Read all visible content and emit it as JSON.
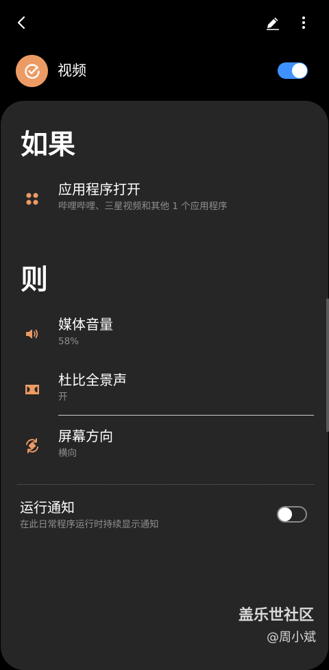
{
  "top_bar": {
    "back_icon": "chevron-left-icon",
    "edit_icon": "pencil-icon",
    "more_icon": "more-vertical-icon"
  },
  "mode": {
    "icon": "check-circle-icon",
    "accent_color": "#ec9b64",
    "title": "视频",
    "enabled": true
  },
  "if_section": {
    "heading": "如果",
    "trigger": {
      "icon": "app-grid-icon",
      "title": "应用程序打开",
      "subtitle": "哔哩哔哩、三星视频和其他 1 个应用程序"
    }
  },
  "then_section": {
    "heading": "则",
    "actions": [
      {
        "icon": "speaker-volume-icon",
        "title": "媒体音量",
        "subtitle": "58%"
      },
      {
        "icon": "dolby-icon",
        "title": "杜比全景声",
        "subtitle": "开"
      },
      {
        "icon": "screen-rotation-icon",
        "title": "屏幕方向",
        "subtitle": "横向"
      }
    ]
  },
  "run_notification": {
    "title": "运行通知",
    "subtitle": "在此日常程序运行时持续显示通知",
    "enabled": false
  },
  "watermark": {
    "main": "盖乐世社区",
    "sub": "@周小斌"
  },
  "colors": {
    "background": "#000000",
    "card": "#262626",
    "toggle_on": "#3e91ff",
    "icon_accent": "#ec9b64",
    "secondary_text": "#8e8e8e"
  }
}
